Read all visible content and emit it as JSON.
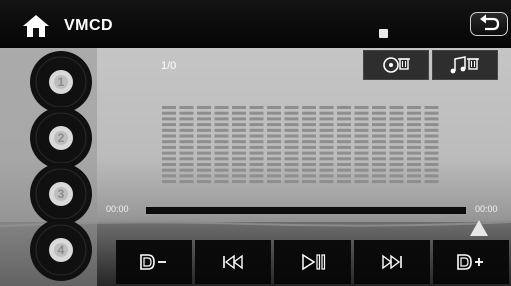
{
  "header": {
    "title": "VMCD",
    "home_icon": "home-icon",
    "back_icon": "back-arrow-icon"
  },
  "discs": [
    {
      "label": "1"
    },
    {
      "label": "2"
    },
    {
      "label": "3"
    },
    {
      "label": "4"
    }
  ],
  "track": {
    "counter": "1/0"
  },
  "toolbar": {
    "delete_disc_icon": "disc-delete-icon",
    "delete_track_icon": "music-delete-icon"
  },
  "playback": {
    "elapsed": "00:00",
    "total": "00:00",
    "progress_fraction": 0
  },
  "controls": [
    {
      "icon": "disc-prev-icon"
    },
    {
      "icon": "skip-back-icon"
    },
    {
      "icon": "play-pause-icon"
    },
    {
      "icon": "skip-forward-icon"
    },
    {
      "icon": "disc-next-icon"
    }
  ],
  "colors": {
    "accent": "#ffffff",
    "panel": "#969696"
  }
}
